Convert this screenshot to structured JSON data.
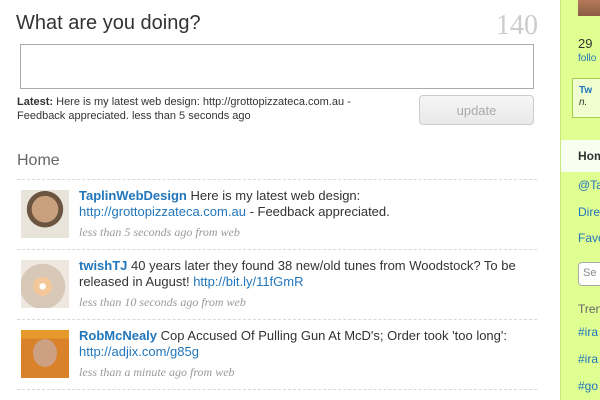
{
  "composer": {
    "prompt": "What are you doing?",
    "counter": "140",
    "input_value": "",
    "latest_label": "Latest:",
    "latest_text": "Here is my latest web design: http://grottopizzateca.com.au - Feedback appreciated. less than 5 seconds ago",
    "update_label": "update"
  },
  "timeline": {
    "heading": "Home",
    "tweets": [
      {
        "user": "TaplinWebDesign",
        "text_before": "Here is my latest web design:",
        "link": "http://grottopizzateca.com.au",
        "text_after": "- Feedback appreciated.",
        "meta": "less than 5 seconds ago from web",
        "avatar_icon": "avatar-photo"
      },
      {
        "user": "twishTJ",
        "text_before": "40 years later they found 38 new/old tunes from Woodstock? To be released in August!",
        "link": "http://bit.ly/11fGmR",
        "text_after": "",
        "meta": "less than 10 seconds ago from web",
        "avatar_icon": "avatar-photo"
      },
      {
        "user": "RobMcNealy",
        "text_before": "Cop Accused Of Pulling Gun At McD's; Order took 'too long':",
        "link": "http://adjix.com/g85g",
        "text_after": "",
        "meta": "less than a minute ago from web",
        "avatar_icon": "avatar-photo"
      }
    ]
  },
  "sidebar": {
    "count": "29",
    "count_label": "follo",
    "latest_name": "Tw",
    "latest_text": "n.",
    "menu": [
      {
        "label": "Hom"
      },
      {
        "label": "@Ta"
      },
      {
        "label": "Dire"
      },
      {
        "label": "Fave"
      }
    ],
    "search_placeholder": "Se",
    "trending_title": "Tren",
    "trends": [
      "#ira",
      "#ira",
      "#go"
    ]
  },
  "colors": {
    "accent": "#2276bb",
    "sidebar_bg": "#e0ff92",
    "sidebar_border": "#a6d14f",
    "counter": "#cccccc"
  }
}
